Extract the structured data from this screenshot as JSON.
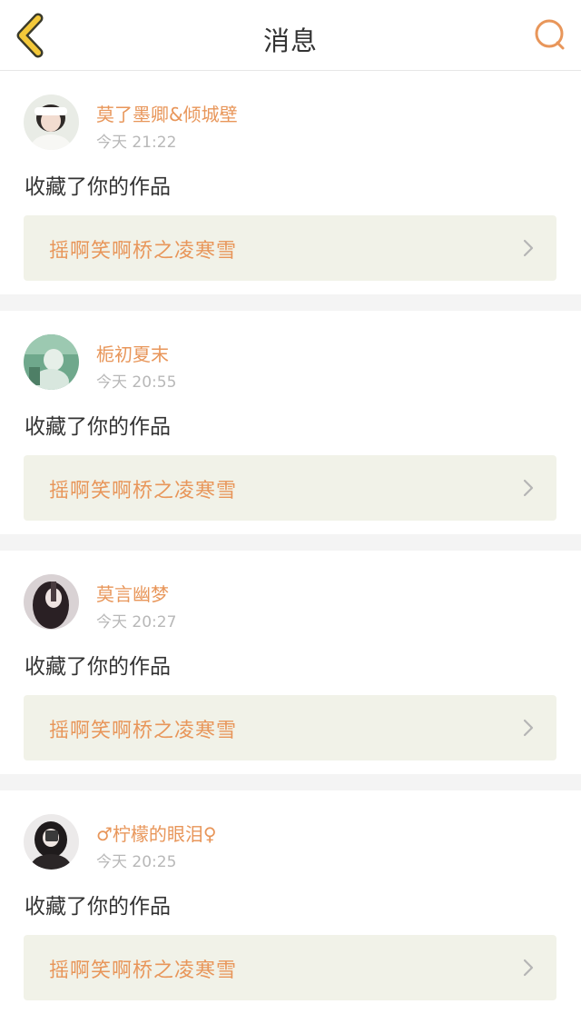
{
  "header": {
    "title": "消息",
    "back_icon": "chevron-left-icon",
    "search_icon": "search-icon"
  },
  "colors": {
    "accent": "#e8965a",
    "back_icon_fill": "#f3c83a",
    "card_link_bg": "#f1f2e8",
    "separator": "#f4f4f4"
  },
  "notifications": [
    {
      "user": "莫了墨卿&倾城壁",
      "time": "今天 21:22",
      "action": "收藏了你的作品",
      "work_title": "摇啊笑啊桥之凌寒雪"
    },
    {
      "user": "栀初夏末",
      "time": "今天 20:55",
      "action": "收藏了你的作品",
      "work_title": "摇啊笑啊桥之凌寒雪"
    },
    {
      "user": "莫言幽梦",
      "time": "今天 20:27",
      "action": "收藏了你的作品",
      "work_title": "摇啊笑啊桥之凌寒雪"
    },
    {
      "user": "♂柠檬的眼泪♀",
      "time": "今天 20:25",
      "action": "收藏了你的作品",
      "work_title": "摇啊笑啊桥之凌寒雪"
    }
  ]
}
